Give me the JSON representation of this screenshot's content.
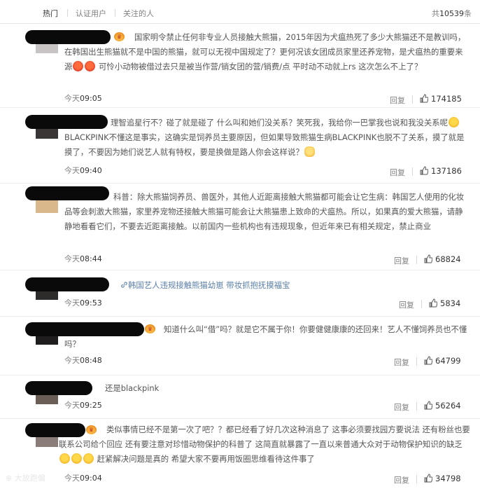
{
  "tabs": [
    {
      "label": "热门",
      "active": true
    },
    {
      "label": "认证用户",
      "active": false
    },
    {
      "label": "关注的人",
      "active": false
    }
  ],
  "total": {
    "prefix": "共",
    "count": "10539",
    "suffix": "条"
  },
  "reply_label": "回复",
  "watermark": "大故跑偏",
  "comments": [
    {
      "text_before": "国家明令禁止任何非专业人员接触大熊猫，2015年因为犬瘟热死了多少大熊猫还不是教训吗，在韩国出生熊猫就不是中国的熊猫，就可以无视中国规定了？更何况该女团成员家里还养宠物，是犬瘟热的重要来源",
      "text_after": "可怜小动物被借过去只是被当作营/销女团的营/销费/点 平时动不动就上rs 这次怎么不上了？",
      "time_prefix": "今天",
      "time": "09:05",
      "likes": "174185"
    },
    {
      "text_before": "理智追星行不？碰了就是碰了 什么叫和她们没关系？笑死我，我给你一巴掌我也说和我没关系呢",
      "text_after": "BLACKPINK不懂这是事实，这确实是饲养员主要原因，但如果导致熊猫生病BLACKPINK也脱不了关系，摸了就是摸了，不要因为她们说艺人就有特权，要是换做是路人你会这样说？",
      "time_prefix": "今天",
      "time": "09:40",
      "likes": "137186"
    },
    {
      "text_before": "科普：除大熊猫饲养员、兽医外，其他人近距离接触大熊猫都可能会让它生病：韩国艺人使用的化妆品等会刺激大熊猫，家里养宠物还接触大熊猫可能会让大熊猫患上致命的犬瘟热。所以，如果真的爱大熊猫，请静静地看看它们，不要去近距离接触。以前国内一些机构也有违规现象，但近年来已有相关规定，禁止商业",
      "time_prefix": "今天",
      "time": "08:44",
      "likes": "68824"
    },
    {
      "link_text": "韩国艺人违规接触熊猫幼崽 带妆抓抱抚摸福宝",
      "time_prefix": "今天",
      "time": "09:53",
      "likes": "5834"
    },
    {
      "text_before": "知道什么叫“借”吗？就是它不属于你！你要健健康康的还回来！艺人不懂饲养员也不懂吗？",
      "time_prefix": "今天",
      "time": "08:48",
      "likes": "64799"
    },
    {
      "text_before": "还是blackpink",
      "time_prefix": "今天",
      "time": "09:25",
      "likes": "56264"
    },
    {
      "text_before": "类似事情已经不是第一次了吧？？都已经看了好几次这种消息了 这事必须要找园方要说法 还有粉丝也要联系公司给个回应 还有要注意对珍惜动物保护的科普了 这简直就暴露了一直以来普通大众对于动物保护知识的缺乏",
      "text_after": "赶紧解决问题是真的 希望大家不要再用饭圈思维看待这件事了",
      "time_prefix": "今天",
      "time": "09:04",
      "likes": "34798"
    }
  ]
}
